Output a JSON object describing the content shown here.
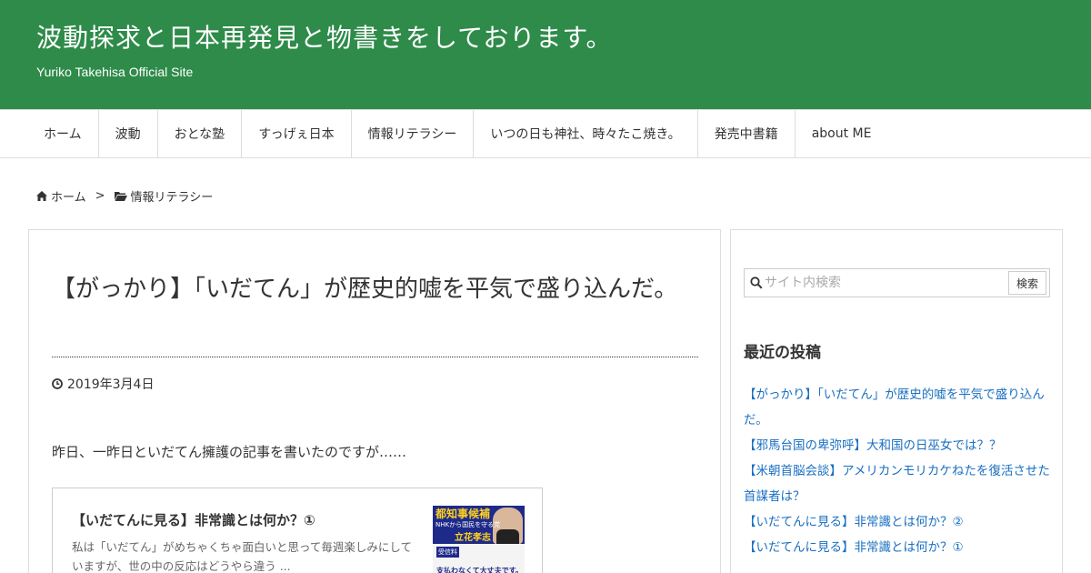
{
  "header": {
    "title": "波動探求と日本再発見と物書きをしております。",
    "subtitle": "Yuriko Takehisa Official Site"
  },
  "nav": {
    "items": [
      {
        "label": "ホーム"
      },
      {
        "label": "波動"
      },
      {
        "label": "おとな塾"
      },
      {
        "label": "すっげぇ日本"
      },
      {
        "label": "情報リテラシー"
      },
      {
        "label": "いつの日も神社、時々たこ焼き。"
      },
      {
        "label": "発売中書籍"
      },
      {
        "label": "about ME"
      }
    ]
  },
  "breadcrumb": {
    "home": "ホーム",
    "separator": ">",
    "category": "情報リテラシー"
  },
  "article": {
    "title": "【がっかり】「いだてん」が歴史的嘘を平気で盛り込んだ。",
    "date": "2019年3月4日",
    "intro": "昨日、一昨日といだてん擁護の記事を書いたのですが……",
    "blogcard": {
      "title": "【いだてんに見る】非常識とは何か？①",
      "excerpt": "私は「いだてん」がめちゃくちゃ面白いと思って毎週楽しみにしていますが、世の中の反応はどうやら違う ...",
      "thumb": {
        "line1": "都知事候補",
        "line2": "NHKから国民を守る党",
        "line3": "立花孝志",
        "badge": "受信料",
        "line4": "支払わなくて大丈夫です。"
      }
    }
  },
  "sidebar": {
    "search": {
      "placeholder": "サイト内検索",
      "button": "検索"
    },
    "recent_title": "最近の投稿",
    "recent_posts": [
      "【がっかり】「いだてん」が歴史的嘘を平気で盛り込んだ。",
      "【邪馬台国の卑弥呼】大和国の日巫女では？？",
      "【米朝首脳会談】アメリカンモリカケねたを復活させた首謀者は？",
      "【いだてんに見る】非常識とは何か？②",
      "【いだてんに見る】非常識とは何か？①"
    ]
  },
  "colors": {
    "header_bg": "#2e8b49",
    "link": "#1a6fc1"
  }
}
